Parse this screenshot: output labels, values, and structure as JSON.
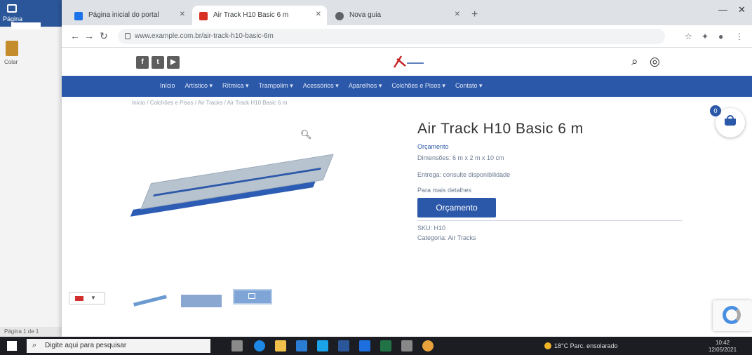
{
  "word": {
    "menu": "Página",
    "paste": "Colar",
    "status": "Página 1 de 1"
  },
  "browser": {
    "tabs": [
      {
        "title": "Página inicial do portal",
        "color": "#1a73e8"
      },
      {
        "title": "Air Track H10 Basic 6 m",
        "color": "#d93025"
      },
      {
        "title": "Nova guia",
        "color": "#5f6368"
      }
    ],
    "new_tab": "+",
    "url": "www.example.com.br/air-track-h10-basic-6m",
    "controls": {
      "minimize": "—",
      "close": "✕"
    }
  },
  "site": {
    "social": [
      "f",
      "t",
      "▶"
    ],
    "nav": [
      "Início",
      "Artístico ▾",
      "Rítmica ▾",
      "Trampolim ▾",
      "Acessórios ▾",
      "Aparelhos ▾",
      "Colchões e Pisos ▾",
      "Contato ▾"
    ],
    "breadcrumb": "Início / Colchões e Pisos / Air Tracks / Air Track H10 Basic 6 m",
    "product": {
      "title": "Air Track H10 Basic 6 m",
      "category": "Orçamento",
      "dimensions": "Dimensões: 6 m x 2 m x 10 cm",
      "delivery": "Entrega: consulte disponibilidade",
      "cta_hint": "Para mais detalhes",
      "button": "Orçamento",
      "sku": "SKU: H10",
      "category_line": "Categoria: Air Tracks"
    },
    "cart_count": "0"
  },
  "taskbar": {
    "search_placeholder": "Digite aqui para pesquisar",
    "tray_text": "18°C Parc. ensolarado",
    "clock_time": "10:42",
    "clock_date": "12/05/2021"
  },
  "colors": {
    "brand": "#2c58a9",
    "taskbar": "#1b1d22"
  }
}
